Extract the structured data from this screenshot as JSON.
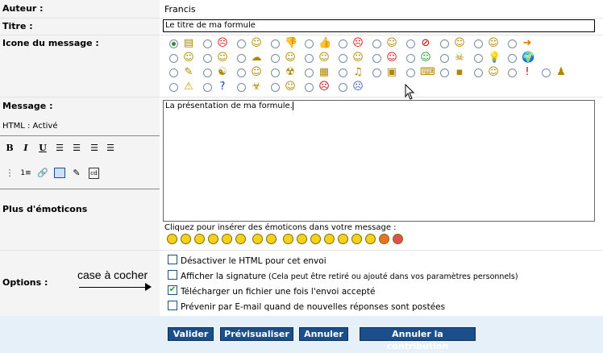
{
  "author": {
    "label": "Auteur :",
    "value": "Francis"
  },
  "title": {
    "label": "Titre :",
    "value": "Le titre de ma formule"
  },
  "icon_section": {
    "label": "Icone du message :",
    "icons_row1": [
      "document-icon",
      "angry-icon",
      "grin-icon",
      "thumbs-down-icon",
      "thumbs-up-icon",
      "red-face-icon",
      "wink-icon",
      "no-entry-icon",
      "cool-icon",
      "neutral-icon",
      "arrow-right-icon"
    ],
    "icons_row2": [
      "sunglasses-icon",
      "glasses-icon",
      "speech-icon",
      "confused-icon",
      "shocked-icon",
      "eyes-icon",
      "tongue-icon",
      "sick-icon",
      "skull-icon",
      "lightbulb-icon",
      "globe-icon"
    ],
    "icons_row3": [
      "pen-icon",
      "yin-yang-icon",
      "dance-icon",
      "radioactive-icon",
      "windows-icon",
      "guitar-icon",
      "tv-icon",
      "computer-icon",
      "floppy-icon",
      "cat-icon",
      "exclamation-icon",
      "penguin-icon"
    ],
    "icons_row4": [
      "warning-icon",
      "question-icon",
      "biohazard-icon",
      "smile-icon",
      "devil-icon",
      "sad-icon"
    ]
  },
  "message": {
    "label": "Message :",
    "html_status": "HTML : Activé",
    "value": "La présentation de ma formule."
  },
  "more_emoticons": {
    "label": "Plus d'émoticons",
    "hint": "Cliquez pour insérer des émoticons dans votre message :"
  },
  "options": {
    "label": "Options :",
    "annotation": "case à cocher",
    "items": [
      {
        "text": "Désactiver le HTML pour cet envoi",
        "checked": false
      },
      {
        "text": "Afficher la signature",
        "note": "(Cela peut être retiré ou ajouté dans vos paramètres personnels)",
        "checked": false
      },
      {
        "text": "Télécharger un fichier une fois l'envoi accepté",
        "checked": true
      },
      {
        "text": "Prévenir par E-mail quand de nouvelles réponses sont postées",
        "checked": false
      }
    ]
  },
  "buttons": {
    "submit": "Valider",
    "preview": "Prévisualiser",
    "cancel": "Annuler",
    "cancel_contribution": "Annuler la contribution"
  },
  "colors": {
    "button_bg": "#1a4f8c",
    "label_bg": "#f4f4f4",
    "footer_bg": "#e6f0f8"
  }
}
